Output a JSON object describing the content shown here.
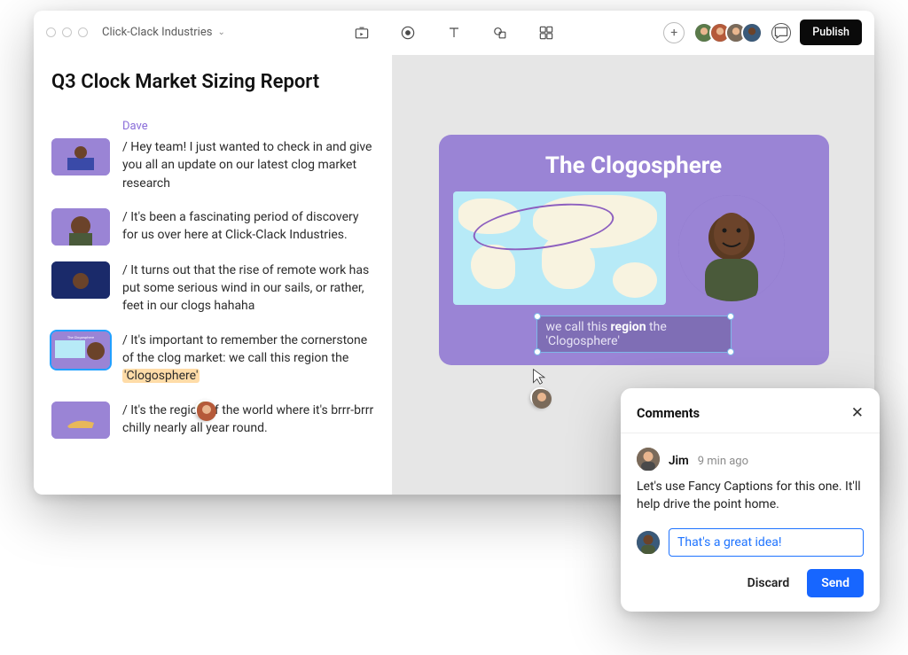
{
  "header": {
    "project_name": "Click-Clack Industries",
    "publish_label": "Publish"
  },
  "document": {
    "title": "Q3 Clock Market Sizing Report",
    "speaker": "Dave",
    "transcript": [
      {
        "text": "/ Hey team! I just wanted to check in and give you all an update on our latest clog market research"
      },
      {
        "text": "/ It's been a fascinating period of discovery for us over here at Click-Clack Industries."
      },
      {
        "text": "/ It turns out that the rise of remote work has put some serious wind in our sails, or rather, feet in our clogs hahaha"
      },
      {
        "text_pre": "/ It's important to remember the cornerstone of the clog market: we call this region the ",
        "highlight": "'Clogosphere'"
      },
      {
        "text": "/ It's the region of the world where it's brrr-brrr chilly nearly all year round."
      }
    ]
  },
  "slide": {
    "title": "The Clogosphere",
    "caption_pre": "we call this ",
    "caption_bold": "region",
    "caption_post": " the 'Clogosphere'"
  },
  "comments": {
    "panel_title": "Comments",
    "author": "Jim",
    "time": "9 min ago",
    "body": "Let's use Fancy Captions for this one. It'll help drive the point home.",
    "reply_value": "That's a great idea!",
    "discard_label": "Discard",
    "send_label": "Send"
  }
}
